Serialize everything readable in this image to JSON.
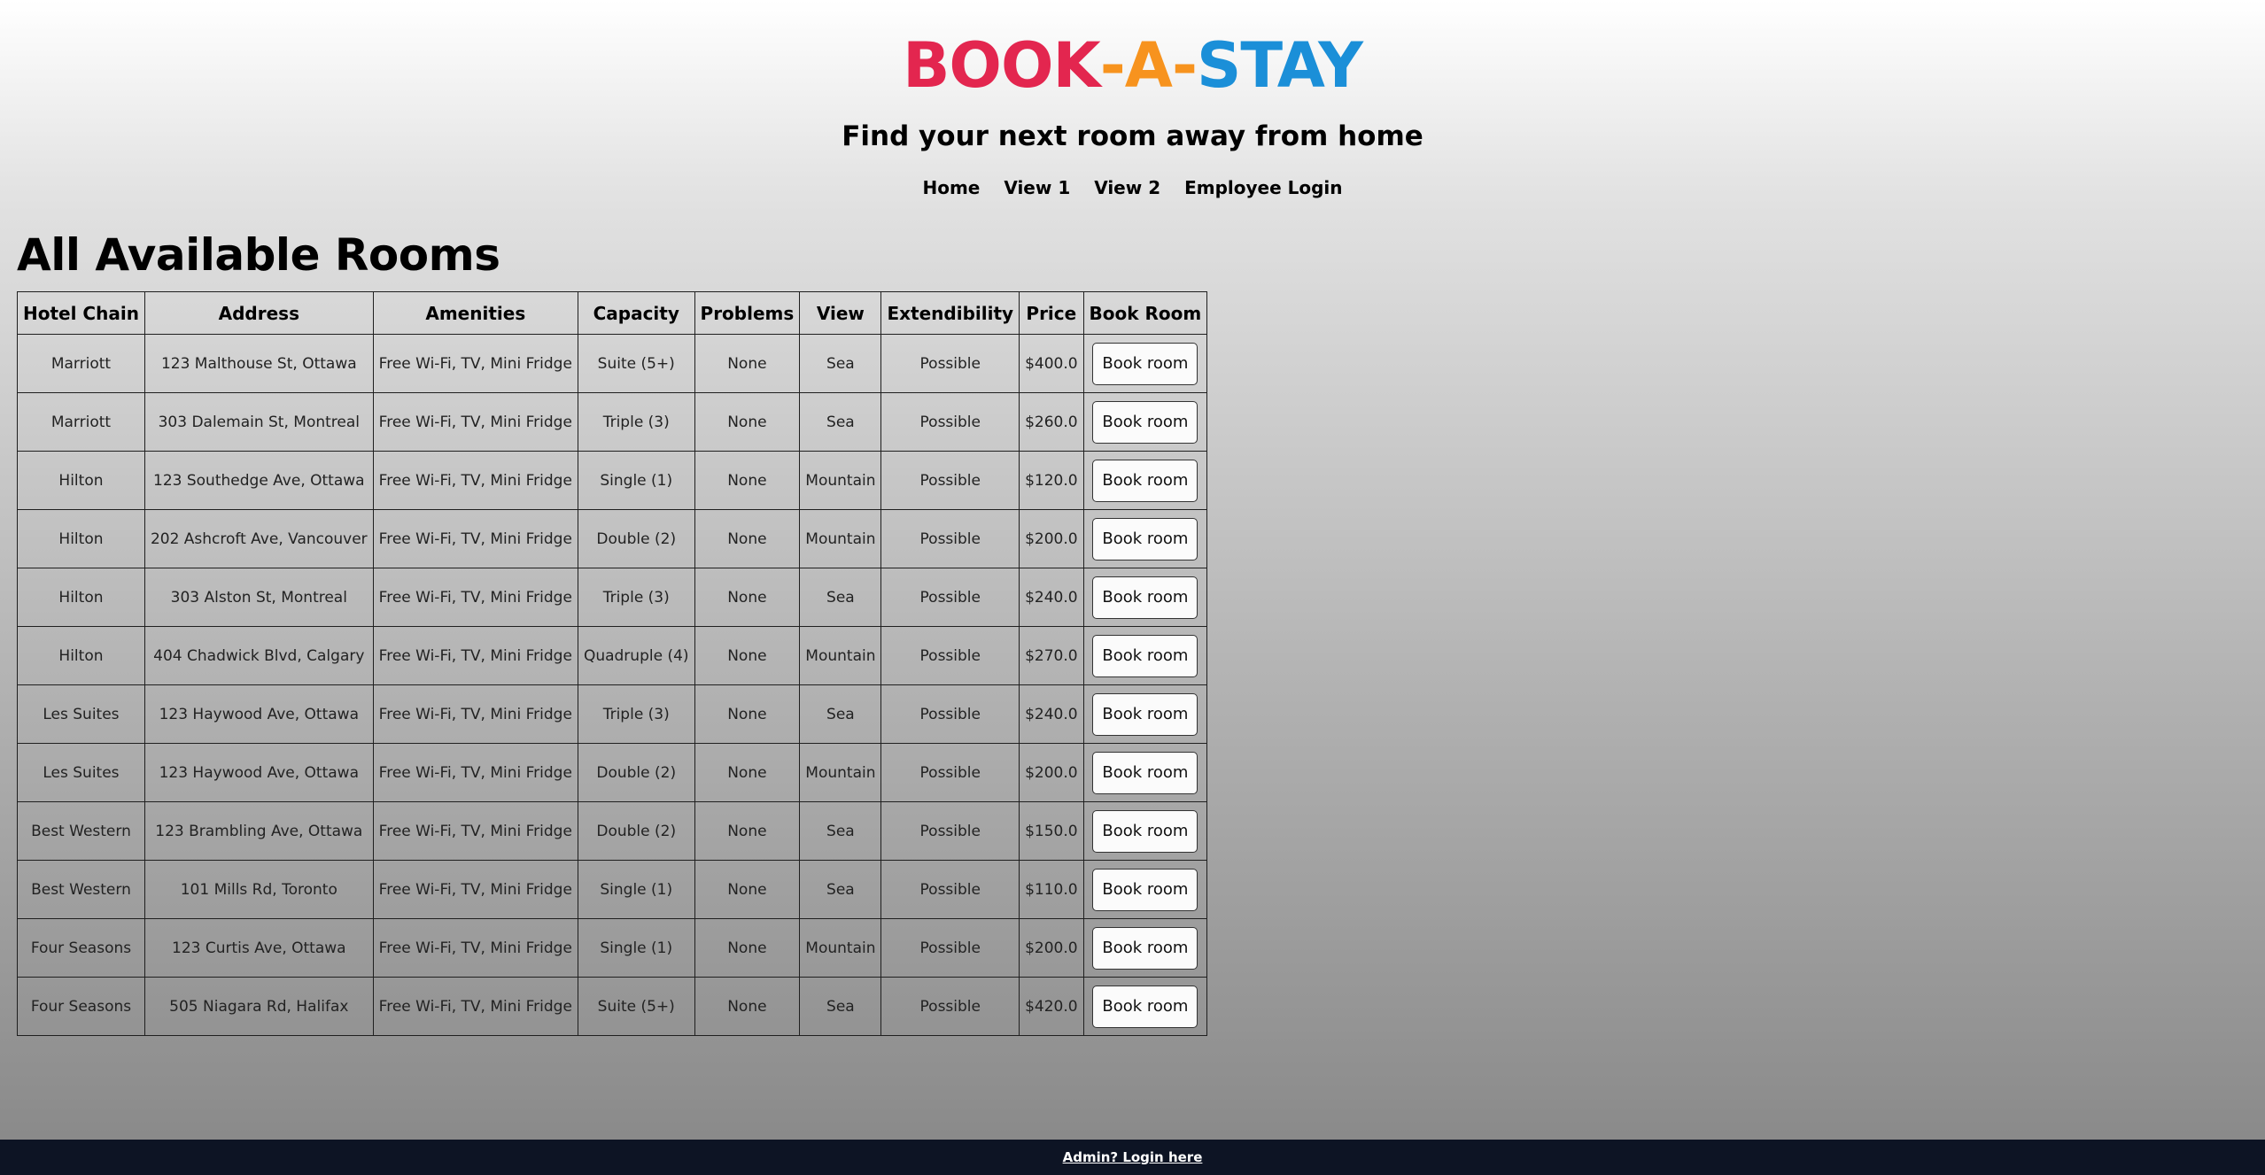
{
  "brand": {
    "part1": "BOOK",
    "sep1": "-",
    "part2": "A",
    "sep2": "-",
    "part3": "STAY",
    "colors": {
      "book": "#e3264f",
      "a": "#f7931e",
      "stay": "#1b8fd8"
    }
  },
  "tagline": "Find your next room away from home",
  "nav": [
    "Home",
    "View 1",
    "View 2",
    "Employee Login"
  ],
  "page_title": "All Available Rooms",
  "table": {
    "headers": [
      "Hotel Chain",
      "Address",
      "Amenities",
      "Capacity",
      "Problems",
      "View",
      "Extendibility",
      "Price",
      "Book Room"
    ],
    "button_label": "Book room",
    "rows": [
      [
        "Marriott",
        "123 Malthouse St, Ottawa",
        "Free Wi-Fi, TV, Mini Fridge",
        "Suite (5+)",
        "None",
        "Sea",
        "Possible",
        "$400.0"
      ],
      [
        "Marriott",
        "303 Dalemain St, Montreal",
        "Free Wi-Fi, TV, Mini Fridge",
        "Triple (3)",
        "None",
        "Sea",
        "Possible",
        "$260.0"
      ],
      [
        "Hilton",
        "123 Southedge Ave, Ottawa",
        "Free Wi-Fi, TV, Mini Fridge",
        "Single (1)",
        "None",
        "Mountain",
        "Possible",
        "$120.0"
      ],
      [
        "Hilton",
        "202 Ashcroft Ave, Vancouver",
        "Free Wi-Fi, TV, Mini Fridge",
        "Double (2)",
        "None",
        "Mountain",
        "Possible",
        "$200.0"
      ],
      [
        "Hilton",
        "303 Alston St, Montreal",
        "Free Wi-Fi, TV, Mini Fridge",
        "Triple (3)",
        "None",
        "Sea",
        "Possible",
        "$240.0"
      ],
      [
        "Hilton",
        "404 Chadwick Blvd, Calgary",
        "Free Wi-Fi, TV, Mini Fridge",
        "Quadruple (4)",
        "None",
        "Mountain",
        "Possible",
        "$270.0"
      ],
      [
        "Les Suites",
        "123 Haywood Ave, Ottawa",
        "Free Wi-Fi, TV, Mini Fridge",
        "Triple (3)",
        "None",
        "Sea",
        "Possible",
        "$240.0"
      ],
      [
        "Les Suites",
        "123 Haywood Ave, Ottawa",
        "Free Wi-Fi, TV, Mini Fridge",
        "Double (2)",
        "None",
        "Mountain",
        "Possible",
        "$200.0"
      ],
      [
        "Best Western",
        "123 Brambling Ave, Ottawa",
        "Free Wi-Fi, TV, Mini Fridge",
        "Double (2)",
        "None",
        "Sea",
        "Possible",
        "$150.0"
      ],
      [
        "Best Western",
        "101 Mills Rd, Toronto",
        "Free Wi-Fi, TV, Mini Fridge",
        "Single (1)",
        "None",
        "Sea",
        "Possible",
        "$110.0"
      ],
      [
        "Four Seasons",
        "123 Curtis Ave, Ottawa",
        "Free Wi-Fi, TV, Mini Fridge",
        "Single (1)",
        "None",
        "Mountain",
        "Possible",
        "$200.0"
      ],
      [
        "Four Seasons",
        "505 Niagara Rd, Halifax",
        "Free Wi-Fi, TV, Mini Fridge",
        "Suite (5+)",
        "None",
        "Sea",
        "Possible",
        "$420.0"
      ]
    ]
  },
  "footer_link": "Admin? Login here"
}
